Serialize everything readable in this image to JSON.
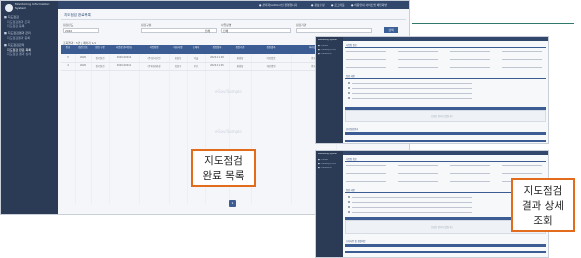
{
  "main_window": {
    "app_name": "Monitoring Information System",
    "topbar": [
      "● 관리자(admin)님 환영합니다",
      "● 정보수정",
      "● 로그아웃",
      "● 이용안내 사이트맵 메인화면"
    ],
    "sidebar": [
      {
        "label": "■ 지도점검",
        "sub": [
          "지도점검결과 조회",
          "지도점검 등록"
        ]
      },
      {
        "label": "■ 지도점검결과 관리",
        "sub": [
          "지도점검결과 등록"
        ]
      },
      {
        "label": "■ 지도점검관리",
        "sub": [
          "지도점검 완료 목록",
          "지도점검 결과 상세"
        ]
      }
    ],
    "page_title": "지도점검 완료목록",
    "filters": [
      {
        "label": "점검년도",
        "value": "2020"
      },
      {
        "label": "점검구분",
        "value": "전체"
      },
      {
        "label": "사업장명",
        "value": "전체"
      },
      {
        "label": "점검기관",
        "value": ""
      }
    ],
    "search_label": "검색",
    "result_info": "조회결과 : 5건  |  페이지 1/1",
    "table_headers": [
      "번호",
      "점검 연도",
      "점검 구분",
      "사업장 관리번호",
      "사업장명",
      "대표자명",
      "소재지",
      "점검일자",
      "점검기관",
      "점검결과",
      "처리상태",
      "비고"
    ],
    "table_rows": [
      [
        "5",
        "2020",
        "정기점검",
        "2020-00012",
        "(주)한국산업",
        "홍길동",
        "서울",
        "2020.11.09",
        "환경청",
        "이상없음",
        "완료",
        "-"
      ],
      [
        "4",
        "2020",
        "정기점검",
        "2020-00011",
        "(주)대한환경",
        "김철수",
        "부산",
        "2020.11.05",
        "환경청",
        "개선명령",
        "완료",
        "-"
      ]
    ],
    "watermarks": [
      "eGov/Sample",
      "eGov/Sample"
    ],
    "page_number": "1"
  },
  "callout_list": {
    "line1": "지도점검",
    "line2": "완료 목록"
  },
  "callout_detail": {
    "line1": "지도점검",
    "line2": "결과 상세",
    "line3": "조회"
  },
  "detail_window": {
    "app_name": "Monitoring System",
    "sections": [
      "사업장 정보",
      "점검 내용",
      "현지점검결과",
      "조치사항 및 행정처분"
    ],
    "empty_text": "조회된 결과가 없습니다"
  }
}
